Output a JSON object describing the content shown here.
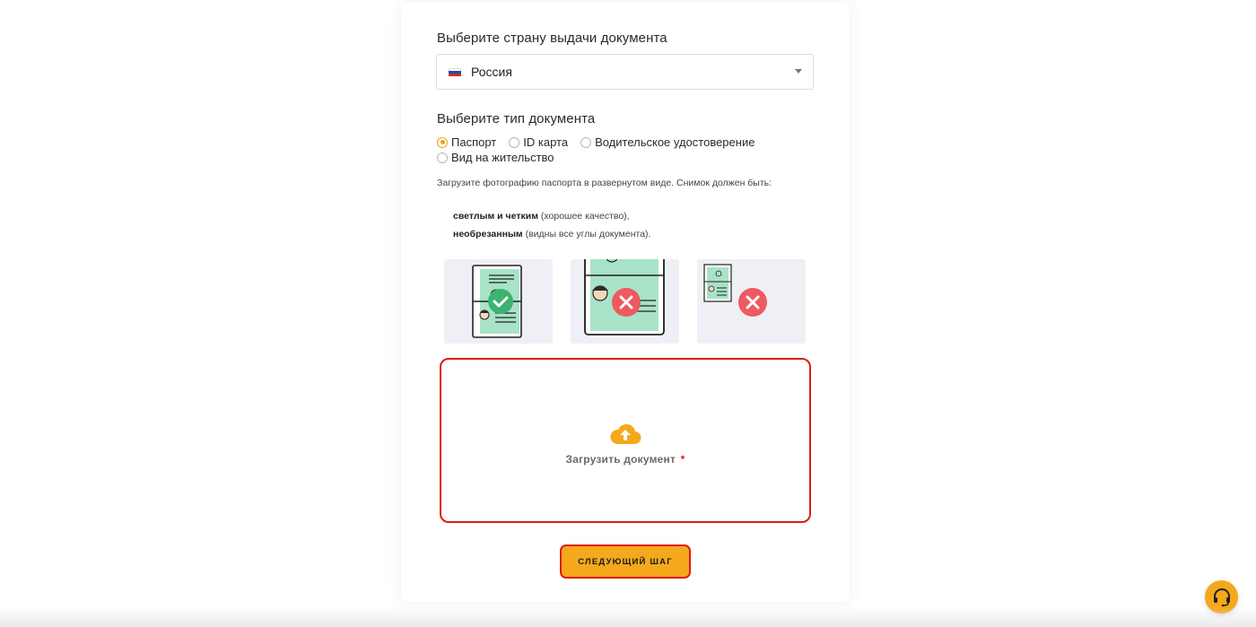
{
  "form": {
    "country_label": "Выберите страну выдачи документа",
    "country_value": "Россия",
    "doc_type_label": "Выберите тип документа",
    "doc_types": [
      {
        "label": "Паспорт",
        "checked": true
      },
      {
        "label": "ID карта",
        "checked": false
      },
      {
        "label": "Водительское удостоверение",
        "checked": false
      },
      {
        "label": "Вид на жительство",
        "checked": false
      }
    ],
    "hint": "Загрузите фотографию паспорта в развернутом виде. Снимок должен быть:",
    "requirements": [
      {
        "bold": "светлым и четким",
        "rest": " (хорошее качество),"
      },
      {
        "bold": "необрезанным",
        "rest": " (видны все углы документа)."
      }
    ],
    "upload_label": "Загрузить документ",
    "upload_required_mark": "*",
    "next_label": "СЛЕДУЮЩИЙ ШАГ"
  },
  "icons": {
    "flag": "russia-flag-icon",
    "caret": "chevron-down-icon",
    "upload": "cloud-upload-icon",
    "support": "headset-icon"
  },
  "colors": {
    "accent": "#f5a81c",
    "error": "#e01a1a",
    "good": "#3cb371",
    "bad": "#ee5a5f"
  }
}
